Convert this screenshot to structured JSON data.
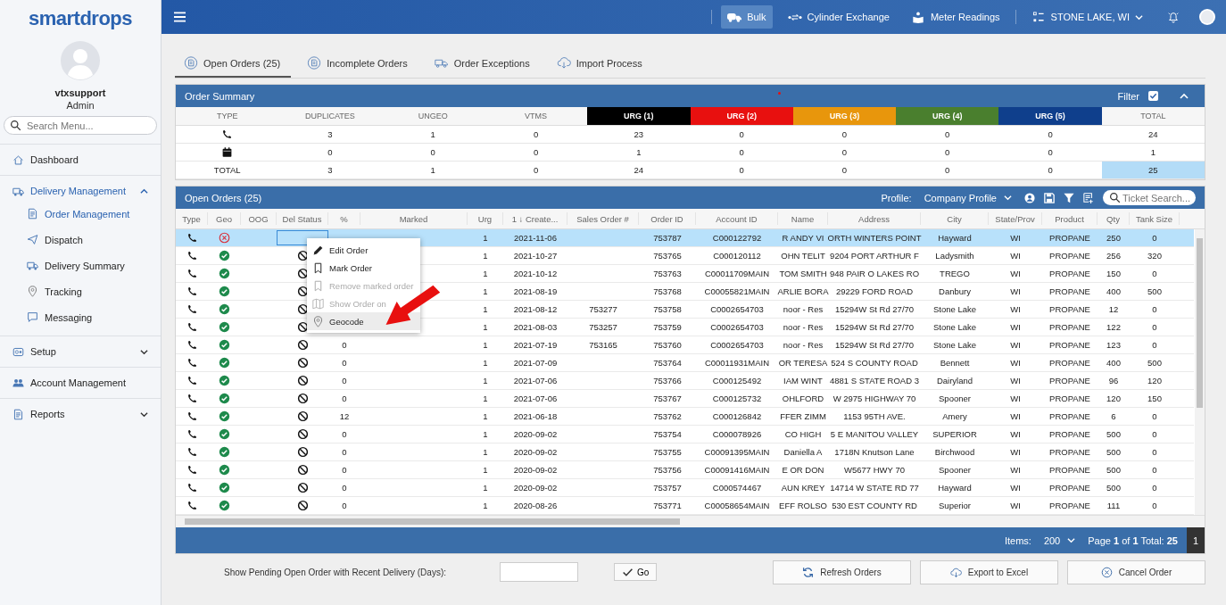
{
  "sidebar": {
    "logo": "smartdrops",
    "user": {
      "name": "vtxsupport",
      "role": "Admin"
    },
    "search": {
      "placeholder": "Search Menu..."
    },
    "items": [
      {
        "label": "Dashboard",
        "selected": false,
        "has_children": false
      },
      {
        "label": "Delivery Management",
        "expanded": true,
        "selected": true,
        "has_children": true,
        "children": [
          {
            "label": "Order Management",
            "selected": true
          },
          {
            "label": "Dispatch",
            "selected": false
          },
          {
            "label": "Delivery Summary",
            "selected": false
          },
          {
            "label": "Tracking",
            "selected": false
          },
          {
            "label": "Messaging",
            "selected": false
          }
        ]
      },
      {
        "label": "Setup",
        "expanded": false,
        "selected": false,
        "has_children": true
      },
      {
        "label": "Account Management",
        "selected": false,
        "has_children": false
      },
      {
        "label": "Reports",
        "expanded": false,
        "selected": false,
        "has_children": true
      }
    ]
  },
  "topbar": {
    "modes": [
      {
        "label": "Bulk",
        "selected": true
      },
      {
        "label": "Cylinder Exchange",
        "selected": false
      },
      {
        "label": "Meter Readings",
        "selected": false
      }
    ],
    "location": "STONE LAKE, WI"
  },
  "tabs": [
    {
      "label": "Open Orders (25)",
      "selected": true
    },
    {
      "label": "Incomplete Orders",
      "selected": false
    },
    {
      "label": "Order Exceptions",
      "selected": false
    },
    {
      "label": "Import Process",
      "selected": false
    }
  ],
  "order_summary": {
    "title": "Order Summary",
    "filter_label": "Filter",
    "filter_checked": true,
    "columns": [
      {
        "label": "TYPE"
      },
      {
        "label": "DUPLICATES"
      },
      {
        "label": "UNGEO"
      },
      {
        "label": "VTMS"
      },
      {
        "label": "URG (1)",
        "color": "#000000"
      },
      {
        "label": "URG (2)",
        "color": "#e8100f"
      },
      {
        "label": "URG (3)",
        "color": "#e8960c"
      },
      {
        "label": "URG (4)",
        "color": "#4a7f2e"
      },
      {
        "label": "URG (5)",
        "color": "#0f3f8c"
      },
      {
        "label": "TOTAL"
      }
    ],
    "rows": [
      {
        "kind": "phone",
        "values": [
          "3",
          "1",
          "0",
          "23",
          "0",
          "0",
          "0",
          "0",
          "24"
        ]
      },
      {
        "kind": "calendar",
        "values": [
          "0",
          "0",
          "0",
          "1",
          "0",
          "0",
          "0",
          "0",
          "1"
        ]
      },
      {
        "kind": "total",
        "label": "TOTAL",
        "values": [
          "3",
          "1",
          "0",
          "24",
          "0",
          "0",
          "0",
          "0",
          "25"
        ]
      }
    ]
  },
  "orders": {
    "title": "Open Orders (25)",
    "profile_label": "Profile:",
    "profile": "Company Profile",
    "search": {
      "placeholder": "Ticket Search..."
    },
    "columns": [
      "Type",
      "Geo",
      "OOG",
      "Del Status",
      "%",
      "Marked",
      "Urg",
      "1 ↓ Create...",
      "Sales Order #",
      "Order ID",
      "Account ID",
      "Name",
      "Address",
      "City",
      "State/Prov",
      "Product",
      "Qty",
      "Tank Size"
    ],
    "rows": [
      {
        "kind": "phone",
        "geo_ok": false,
        "del_blocked": false,
        "del_focused": true,
        "urg": "1",
        "created": "2021-11-06",
        "order_id": "753787",
        "account_id": "C000122792",
        "name": "R ANDY VI",
        "address": "ORTH WINTERS POINT",
        "city": "Hayward",
        "state": "WI",
        "product": "PROPANE",
        "qty": "250",
        "tank_size": "0",
        "selected": true
      },
      {
        "kind": "phone",
        "geo_ok": true,
        "del_blocked": true,
        "del_focused": false,
        "urg": "1",
        "created": "2021-10-27",
        "order_id": "753765",
        "account_id": "C000120112",
        "name": "OHN TELIT",
        "address": "9204 PORT ARTHUR F",
        "city": "Ladysmith",
        "state": "WI",
        "product": "PROPANE",
        "qty": "256",
        "tank_size": "320",
        "selected": false
      },
      {
        "kind": "phone",
        "geo_ok": true,
        "del_blocked": true,
        "del_focused": false,
        "urg": "1",
        "created": "2021-10-12",
        "order_id": "753763",
        "account_id": "C00011709MAIN",
        "name": "TOM SMITH",
        "address": "948 PAIR O LAKES RO",
        "city": "TREGO",
        "state": "WI",
        "product": "PROPANE",
        "qty": "150",
        "tank_size": "0",
        "selected": false
      },
      {
        "kind": "phone",
        "geo_ok": true,
        "del_blocked": true,
        "del_focused": false,
        "urg": "1",
        "created": "2021-08-19",
        "order_id": "753768",
        "account_id": "C00055821MAIN",
        "name": "ARLIE BORA",
        "address": "29229 FORD ROAD",
        "city": "Danbury",
        "state": "WI",
        "product": "PROPANE",
        "qty": "400",
        "tank_size": "500",
        "selected": false
      },
      {
        "kind": "phone",
        "geo_ok": true,
        "del_blocked": true,
        "del_focused": false,
        "urg": "1",
        "created": "2021-08-12",
        "sales_order": "753277",
        "order_id": "753758",
        "account_id": "C0002654703",
        "name": "noor - Res",
        "address": "15294W St Rd 27/70",
        "city": "Stone Lake",
        "state": "WI",
        "product": "PROPANE",
        "qty": "12",
        "tank_size": "0",
        "selected": false
      },
      {
        "kind": "phone",
        "geo_ok": true,
        "del_blocked": true,
        "del_focused": false,
        "urg": "1",
        "created": "2021-08-03",
        "sales_order": "753257",
        "order_id": "753759",
        "account_id": "C0002654703",
        "name": "noor - Res",
        "address": "15294W St Rd 27/70",
        "city": "Stone Lake",
        "state": "WI",
        "product": "PROPANE",
        "qty": "122",
        "tank_size": "0",
        "selected": false
      },
      {
        "kind": "phone",
        "geo_ok": true,
        "del_blocked": true,
        "del_focused": false,
        "pct": "0",
        "urg": "1",
        "created": "2021-07-19",
        "sales_order": "753165",
        "order_id": "753760",
        "account_id": "C0002654703",
        "name": "noor - Res",
        "address": "15294W St Rd 27/70",
        "city": "Stone Lake",
        "state": "WI",
        "product": "PROPANE",
        "qty": "123",
        "tank_size": "0",
        "selected": false
      },
      {
        "kind": "phone",
        "geo_ok": true,
        "del_blocked": true,
        "del_focused": false,
        "pct": "0",
        "urg": "1",
        "created": "2021-07-09",
        "order_id": "753764",
        "account_id": "C00011931MAIN",
        "name": "OR TERESA",
        "address": "524 S COUNTY ROAD",
        "city": "Bennett",
        "state": "WI",
        "product": "PROPANE",
        "qty": "400",
        "tank_size": "500",
        "selected": false
      },
      {
        "kind": "phone",
        "geo_ok": true,
        "del_blocked": true,
        "del_focused": false,
        "pct": "0",
        "urg": "1",
        "created": "2021-07-06",
        "order_id": "753766",
        "account_id": "C000125492",
        "name": "IAM WINT",
        "address": "4881 S STATE ROAD 3",
        "city": "Dairyland",
        "state": "WI",
        "product": "PROPANE",
        "qty": "96",
        "tank_size": "120",
        "selected": false
      },
      {
        "kind": "phone",
        "geo_ok": true,
        "del_blocked": true,
        "del_focused": false,
        "pct": "0",
        "urg": "1",
        "created": "2021-07-06",
        "order_id": "753767",
        "account_id": "C000125732",
        "name": "OHLFORD",
        "address": "W 2975 HIGHWAY 70",
        "city": "Spooner",
        "state": "WI",
        "product": "PROPANE",
        "qty": "120",
        "tank_size": "150",
        "selected": false
      },
      {
        "kind": "phone",
        "geo_ok": true,
        "del_blocked": true,
        "del_focused": false,
        "pct": "12",
        "urg": "1",
        "created": "2021-06-18",
        "order_id": "753762",
        "account_id": "C000126842",
        "name": "FFER ZIMM",
        "address": "1153 95TH AVE.",
        "city": "Amery",
        "state": "WI",
        "product": "PROPANE",
        "qty": "6",
        "tank_size": "0",
        "selected": false
      },
      {
        "kind": "phone",
        "geo_ok": true,
        "del_blocked": true,
        "del_focused": false,
        "pct": "0",
        "urg": "1",
        "created": "2020-09-02",
        "order_id": "753754",
        "account_id": "C000078926",
        "name": "CO HIGH",
        "address": "5 E MANITOU VALLEY",
        "city": "SUPERIOR",
        "state": "WI",
        "product": "PROPANE",
        "qty": "500",
        "tank_size": "0",
        "selected": false
      },
      {
        "kind": "phone",
        "geo_ok": true,
        "del_blocked": true,
        "del_focused": false,
        "pct": "0",
        "urg": "1",
        "created": "2020-09-02",
        "order_id": "753755",
        "account_id": "C00091395MAIN",
        "name": "Daniella A",
        "address": "1718N Knutson Lane",
        "city": "Birchwood",
        "state": "WI",
        "product": "PROPANE",
        "qty": "500",
        "tank_size": "0",
        "selected": false
      },
      {
        "kind": "phone",
        "geo_ok": true,
        "del_blocked": true,
        "del_focused": false,
        "pct": "0",
        "urg": "1",
        "created": "2020-09-02",
        "order_id": "753756",
        "account_id": "C00091416MAIN",
        "name": "E OR DON",
        "address": "W5677 HWY 70",
        "city": "Spooner",
        "state": "WI",
        "product": "PROPANE",
        "qty": "500",
        "tank_size": "0",
        "selected": false
      },
      {
        "kind": "phone",
        "geo_ok": true,
        "del_blocked": true,
        "del_focused": false,
        "pct": "0",
        "urg": "1",
        "created": "2020-09-02",
        "order_id": "753757",
        "account_id": "C000574467",
        "name": "AUN KREY",
        "address": "14714 W STATE RD 77",
        "city": "Hayward",
        "state": "WI",
        "product": "PROPANE",
        "qty": "500",
        "tank_size": "0",
        "selected": false
      },
      {
        "kind": "phone",
        "geo_ok": true,
        "del_blocked": true,
        "del_focused": false,
        "pct": "0",
        "urg": "1",
        "created": "2020-08-26",
        "order_id": "753771",
        "account_id": "C00058654MAIN",
        "name": "EFF ROLSO",
        "address": "530 EST COUNTY RD",
        "city": "Superior",
        "state": "WI",
        "product": "PROPANE",
        "qty": "111",
        "tank_size": "0",
        "selected": false
      }
    ],
    "context_menu": [
      {
        "label": "Edit Order",
        "disabled": false,
        "selected": false
      },
      {
        "label": "Mark Order",
        "disabled": false,
        "selected": false
      },
      {
        "label": "Remove marked order",
        "disabled": true,
        "selected": false
      },
      {
        "label": "Show Order on",
        "disabled": true,
        "selected": false
      },
      {
        "label": "Geocode",
        "disabled": false,
        "selected": true
      }
    ],
    "footer": {
      "items_label": "Items:",
      "items_value": "200",
      "page_info": "Page **1** of **1** Total: **25**",
      "page_button": "1"
    }
  },
  "bottom": {
    "pending_label": "Show Pending Open Order with Recent Delivery (Days):",
    "go": "Go",
    "buttons": [
      {
        "label": "Refresh Orders"
      },
      {
        "label": "Export to Excel"
      },
      {
        "label": "Cancel Order"
      }
    ]
  }
}
